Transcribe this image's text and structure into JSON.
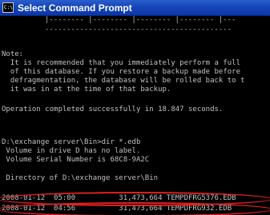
{
  "window": {
    "title": "Select Command Prompt",
    "icon_text": "C:\\"
  },
  "console": {
    "dashes_top": "|-------- |-------- |-------- |-------- |---",
    "dashes_bottom": "-------------------------------------------",
    "lines": [
      "Note:",
      "  It is recommended that you immediately perform a full",
      "  of this database. If you restore a backup made before",
      "  defragmentation, the database will be rolled back to t",
      "  it was in at the time of that backup.",
      "",
      "Operation completed successfully in 18.847 seconds.",
      "",
      "",
      "D:\\exchange server\\Bin>dir *.edb",
      " Volume in drive D has no label.",
      " Volume Serial Number is 68C8-9A2C",
      "",
      " Directory of D:\\exchange server\\Bin",
      "",
      "2008-01-12  05:00          31,473,664 TEMPDFRG5376.EDB",
      "2008-01-12  04:56          31,473,664 TEMPDFRG932.EDB"
    ]
  },
  "colors": {
    "console_bg": "#000000",
    "console_text": "#c0c0c0",
    "titlebar": "#0a36a8",
    "highlight": "#e02020"
  }
}
